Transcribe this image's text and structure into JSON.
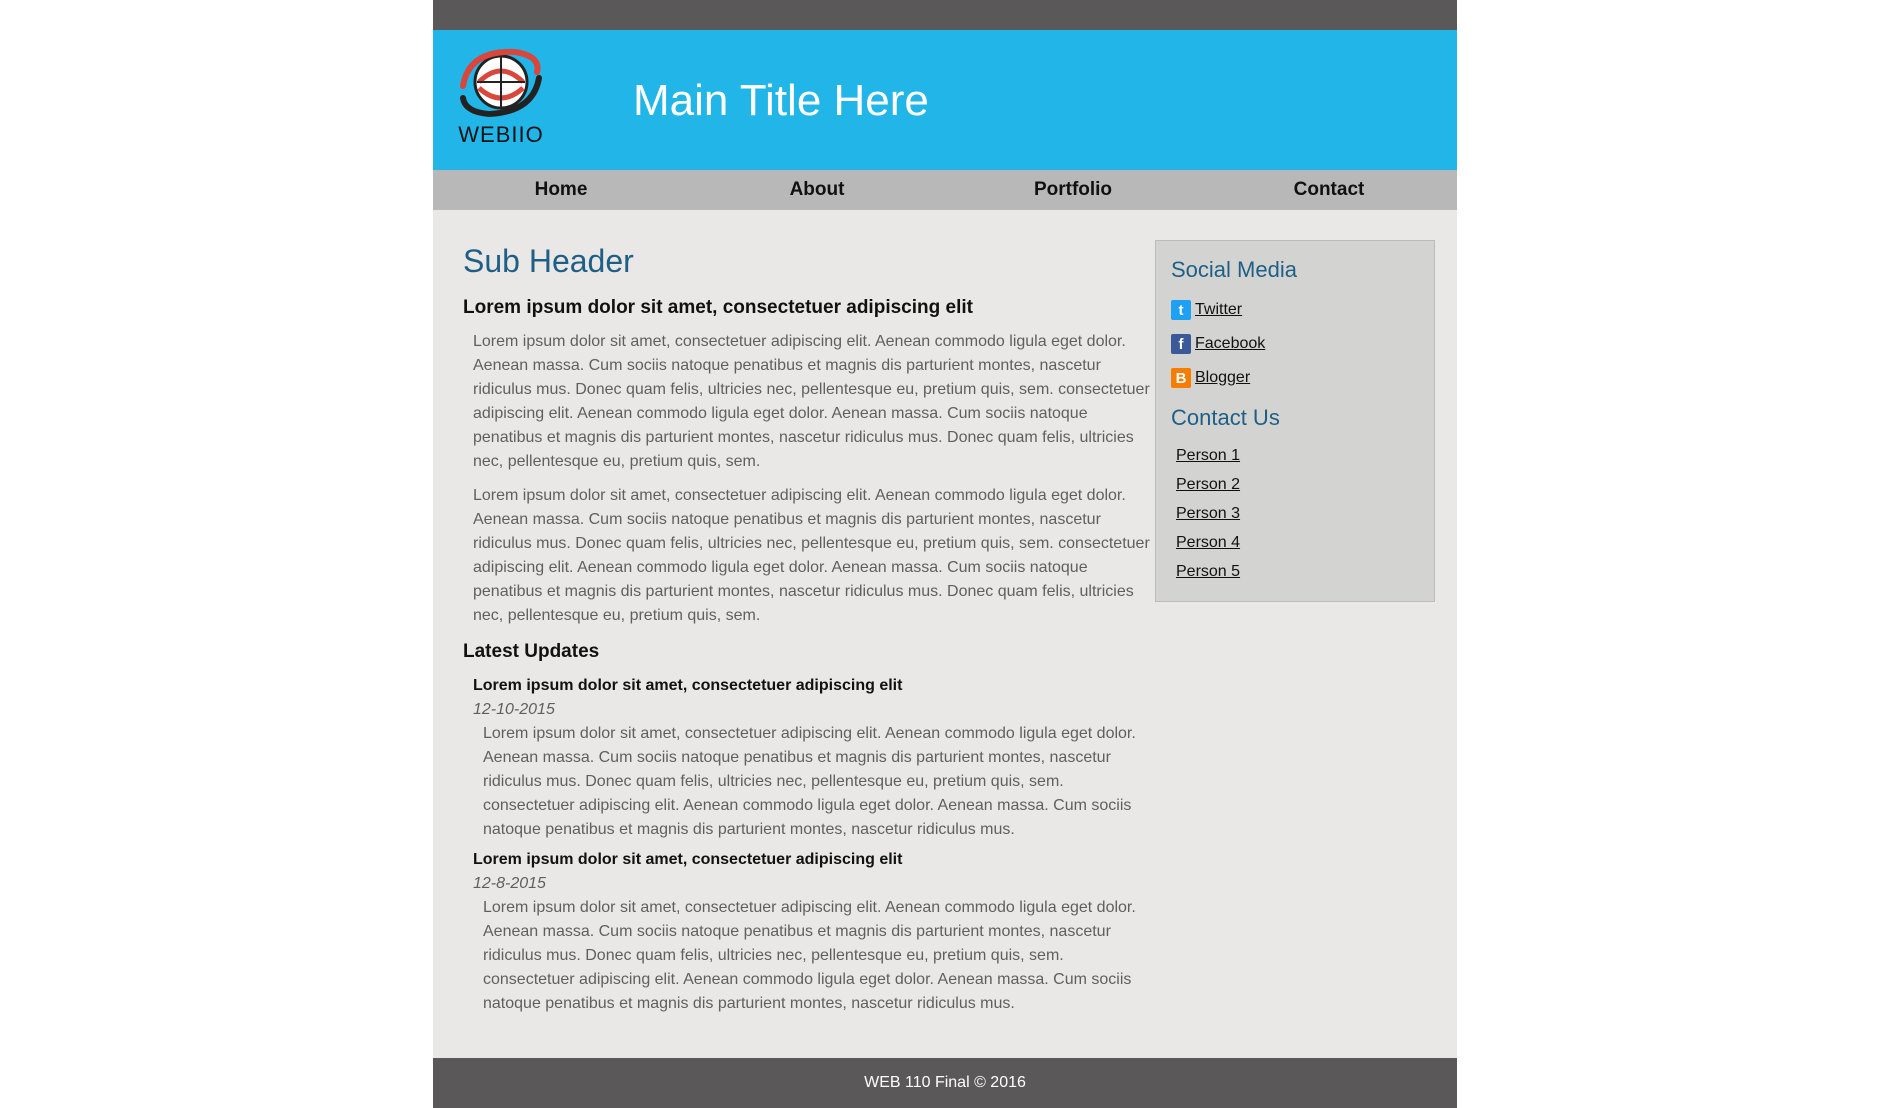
{
  "header": {
    "logo_text": "WEBIIO",
    "main_title": "Main Title Here"
  },
  "nav": {
    "items": [
      "Home",
      "About",
      "Portfolio",
      "Contact"
    ]
  },
  "main": {
    "sub_header": "Sub Header",
    "intro_heading": "Lorem ipsum dolor sit amet, consectetuer adipiscing elit",
    "paragraphs": [
      "Lorem ipsum dolor sit amet, consectetuer adipiscing elit. Aenean commodo ligula eget dolor. Aenean massa. Cum sociis natoque penatibus et magnis dis parturient montes, nascetur ridiculus mus. Donec quam felis, ultricies nec, pellentesque eu, pretium quis, sem. consectetuer adipiscing elit. Aenean commodo ligula eget dolor. Aenean massa. Cum sociis natoque penatibus et magnis dis parturient montes, nascetur ridiculus mus. Donec quam felis, ultricies nec, pellentesque eu, pretium quis, sem.",
      "Lorem ipsum dolor sit amet, consectetuer adipiscing elit. Aenean commodo ligula eget dolor. Aenean massa. Cum sociis natoque penatibus et magnis dis parturient montes, nascetur ridiculus mus. Donec quam felis, ultricies nec, pellentesque eu, pretium quis, sem. consectetuer adipiscing elit. Aenean commodo ligula eget dolor. Aenean massa. Cum sociis natoque penatibus et magnis dis parturient montes, nascetur ridiculus mus. Donec quam felis, ultricies nec, pellentesque eu, pretium quis, sem."
    ],
    "updates_title": "Latest Updates",
    "updates": [
      {
        "title": "Lorem ipsum dolor sit amet, consectetuer adipiscing elit",
        "date": "12-10-2015",
        "text": "Lorem ipsum dolor sit amet, consectetuer adipiscing elit. Aenean commodo ligula eget dolor. Aenean massa. Cum sociis natoque penatibus et magnis dis parturient montes, nascetur ridiculus mus. Donec quam felis, ultricies nec, pellentesque eu, pretium quis, sem. consectetuer adipiscing elit. Aenean commodo ligula eget dolor. Aenean massa. Cum sociis natoque penatibus et magnis dis parturient montes, nascetur ridiculus mus."
      },
      {
        "title": "Lorem ipsum dolor sit amet, consectetuer adipiscing elit",
        "date": "12-8-2015",
        "text": "Lorem ipsum dolor sit amet, consectetuer adipiscing elit. Aenean commodo ligula eget dolor. Aenean massa. Cum sociis natoque penatibus et magnis dis parturient montes, nascetur ridiculus mus. Donec quam felis, ultricies nec, pellentesque eu, pretium quis, sem. consectetuer adipiscing elit. Aenean commodo ligula eget dolor. Aenean massa. Cum sociis natoque penatibus et magnis dis parturient montes, nascetur ridiculus mus."
      }
    ]
  },
  "sidebar": {
    "social_heading": "Social Media",
    "social": [
      {
        "label": "Twitter",
        "icon": "twitter-icon",
        "glyph": "t",
        "color": "#1da1f2"
      },
      {
        "label": "Facebook",
        "icon": "facebook-icon",
        "glyph": "f",
        "color": "#3b5998"
      },
      {
        "label": "Blogger",
        "icon": "blogger-icon",
        "glyph": "B",
        "color": "#f57d00"
      }
    ],
    "contact_heading": "Contact Us",
    "contacts": [
      "Person 1",
      "Person 2",
      "Person 3",
      "Person 4",
      "Person 5"
    ]
  },
  "footer": {
    "text": "WEB 110 Final © 2016"
  },
  "colors": {
    "header_bg": "#21b5e8",
    "bar_bg": "#5a5859",
    "nav_bg": "#b8b8b8",
    "accent_heading": "#1f5f85"
  }
}
